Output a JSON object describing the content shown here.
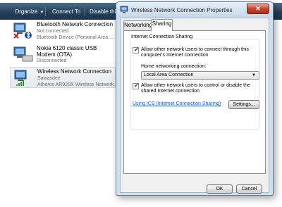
{
  "toolbar": {
    "organize_label": "Organize",
    "connect_label": "Connect To",
    "disable_label": "Disable this"
  },
  "connections": [
    {
      "name": "Bluetooth Network Connection",
      "status": "Not connected",
      "device": "Bluetooth Device (Personal Area ..."
    },
    {
      "name": "Nokia 6120 classic USB Modem (OTA)",
      "status": "Disconnected"
    },
    {
      "name": "Wireless Network Connection",
      "status": "Sawasdee",
      "device": "Atheros AR928X Wireless Network..."
    }
  ],
  "dialog": {
    "title": "Wireless Network Connection Properties",
    "close_glyph": "✕",
    "tabs": [
      "Networking",
      "Sharing"
    ],
    "active_tab": "Sharing",
    "group_title": "Internet Connection Sharing",
    "allow_connect_label": "Allow other network users to connect through this computer's Internet connection",
    "allow_connect_checked": true,
    "home_networking_label": "Home networking connection:",
    "home_networking_value": "Local Area Connection",
    "allow_control_label": "Allow other network users to control or disable the shared Internet connection",
    "allow_control_checked": true,
    "ics_link": "Using ICS (Internet Connection Sharing)",
    "settings_label": "Settings...",
    "ok_label": "OK",
    "cancel_label": "Cancel"
  },
  "icons": {
    "check_glyph": "✓",
    "dropdown_glyph": "▼"
  }
}
